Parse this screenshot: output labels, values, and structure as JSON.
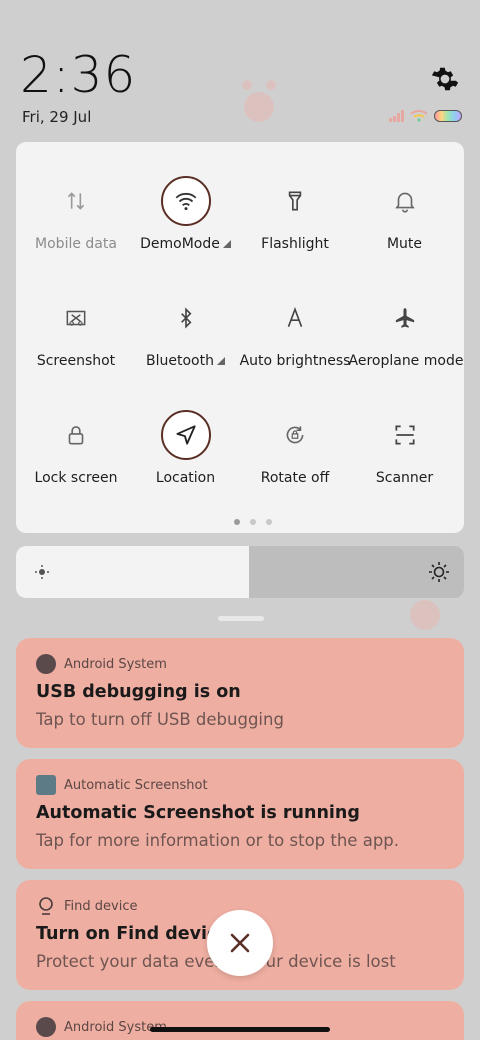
{
  "status": {
    "time": "2:36",
    "date": "Fri, 29 Jul"
  },
  "quick_settings": {
    "tiles": [
      {
        "label": "Mobile data",
        "icon": "mobile-data-icon",
        "active": false,
        "dim": true
      },
      {
        "label": "DemoMode",
        "icon": "wifi-icon",
        "active": true,
        "dim": false,
        "expand": true
      },
      {
        "label": "Flashlight",
        "icon": "flashlight-icon",
        "active": false,
        "dim": false
      },
      {
        "label": "Mute",
        "icon": "bell-icon",
        "active": false,
        "dim": false
      },
      {
        "label": "Screenshot",
        "icon": "screenshot-icon",
        "active": false,
        "dim": false
      },
      {
        "label": "Bluetooth",
        "icon": "bluetooth-icon",
        "active": false,
        "dim": false,
        "expand": true
      },
      {
        "label": "Auto brightness",
        "icon": "auto-brightness-icon",
        "active": false,
        "dim": false
      },
      {
        "label": "Aeroplane mode",
        "icon": "airplane-icon",
        "active": false,
        "dim": false
      },
      {
        "label": "Lock screen",
        "icon": "lock-icon",
        "active": false,
        "dim": false
      },
      {
        "label": "Location",
        "icon": "location-icon",
        "active": true,
        "dim": false
      },
      {
        "label": "Rotate off",
        "icon": "rotate-lock-icon",
        "active": false,
        "dim": false
      },
      {
        "label": "Scanner",
        "icon": "scanner-icon",
        "active": false,
        "dim": false
      }
    ]
  },
  "brightness": {
    "level": 0.52
  },
  "notifications": [
    {
      "app": "Android System",
      "title": "USB debugging is on",
      "body": "Tap to turn off USB debugging"
    },
    {
      "app": "Automatic Screenshot",
      "title": "Automatic Screenshot is running",
      "body": "Tap for more information or to stop the app."
    },
    {
      "app": "Find device",
      "title": "Turn on Find device",
      "body": "Protect your data even if your device is lost"
    },
    {
      "app": "Android System"
    }
  ],
  "colors": {
    "notification_bg": "#efaea2",
    "active_ring": "#5a2f25",
    "panel_bg": "#f3f3f3"
  }
}
